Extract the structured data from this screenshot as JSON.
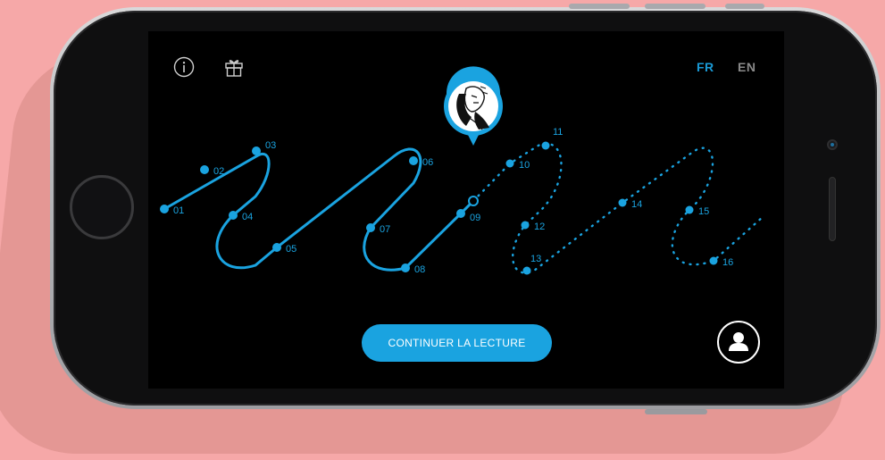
{
  "header": {
    "info_icon": "info-icon",
    "gift_icon": "gift-icon",
    "languages": [
      {
        "label": "FR",
        "active": true
      },
      {
        "label": "EN",
        "active": false
      }
    ]
  },
  "journey": {
    "steps": [
      "01",
      "02",
      "03",
      "04",
      "05",
      "06",
      "07",
      "08",
      "09",
      "10",
      "11",
      "12",
      "13",
      "14",
      "15",
      "16"
    ],
    "completed_through": "09",
    "current_step": "09",
    "avatar": "character-portrait"
  },
  "footer": {
    "continue_label": "CONTINUER LA LECTURE",
    "profile_icon": "user-icon"
  },
  "colors": {
    "accent": "#1aa3e0",
    "screen_background": "#000000",
    "text_light": "#ffffff",
    "language_inactive": "#8a8a8a"
  }
}
